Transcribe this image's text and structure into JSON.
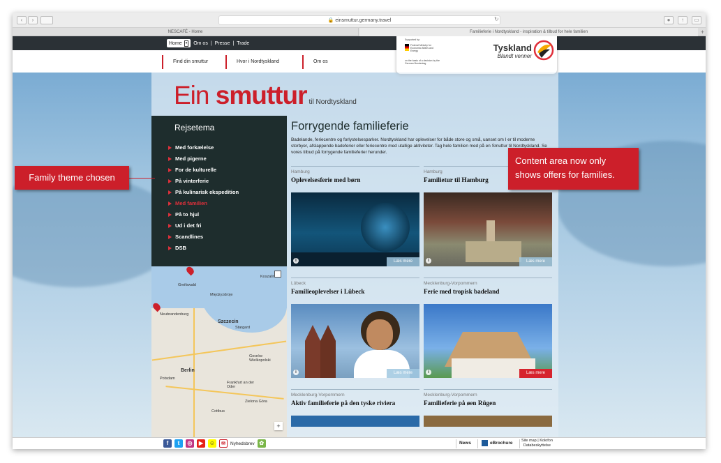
{
  "browser": {
    "url": "einsmuttur.germany.travel",
    "tabs": [
      {
        "label": "NESCAFÉ - Home"
      },
      {
        "label": "Familieferie i Nordtyskland - inspiration & tilbud for hele familien"
      }
    ],
    "new_tab_label": "+"
  },
  "topbar": {
    "home_label": "Home",
    "links": [
      "Om os",
      "Presse",
      "Trade"
    ]
  },
  "nav": {
    "items": [
      "Find din smuttur",
      "Hvor i Nordtyskland",
      "Om os"
    ]
  },
  "logo": {
    "supported_by": "Supported by:",
    "ministry": "Federal Ministry for Economic Affairs and Energy",
    "decision": "on the basis of a decision by the German Bundestag",
    "brand": "Tyskland",
    "tagline": "Blandt venner"
  },
  "site_title": {
    "ein": "Ein ",
    "smuttur": "smuttur",
    "suffix": "til Nordtyskland"
  },
  "menu": {
    "heading": "Rejsetema",
    "items": [
      {
        "label": "Med forkælelse",
        "active": false
      },
      {
        "label": "Med pigerne",
        "active": false
      },
      {
        "label": "For de kulturelle",
        "active": false
      },
      {
        "label": "På vinterferie",
        "active": false
      },
      {
        "label": "På kulinarisk ekspedition",
        "active": false
      },
      {
        "label": "Med familien",
        "active": true
      },
      {
        "label": "På to hjul",
        "active": false
      },
      {
        "label": "Ud i det fri",
        "active": false
      },
      {
        "label": "Scandlines",
        "active": false
      },
      {
        "label": "DSB",
        "active": false
      }
    ]
  },
  "map": {
    "labels": [
      "Greifswald",
      "Neubrandenburg",
      "Szczecin",
      "Stargard",
      "Gorzów Wielkopolski",
      "Berlin",
      "Potsdam",
      "Frankfurt an der Oder",
      "Zielona Góra",
      "Cottbus",
      "Międzyzdroje",
      "Koszalin"
    ],
    "zoom_label": "+"
  },
  "main": {
    "heading": "Forrygende familieferie",
    "intro": "Badelande, feriecentre og forlystelsesparker. Nordtyskland har oplevelser for både store og små, uanset om I er til moderne storbyer, afslappende badeferier eller feriecentre med utallige aktiviteter. Tag hele familien med på en Smuttur til Nordtyskland. Se vores tilbud på forrygende familieferier herunder.",
    "read_more": "Læs mere",
    "cards": [
      {
        "region": "Hamburg",
        "title": "Oplevelsesferie med børn"
      },
      {
        "region": "Hamburg",
        "title": "Familietur til Hamburg"
      },
      {
        "region": "Lübeck",
        "title": "Familieoplevelser i Lübeck"
      },
      {
        "region": "Mecklenburg-Vorpommern",
        "title": "Ferie med tropisk badeland"
      },
      {
        "region": "Mecklenburg-Vorpommern",
        "title": "Aktiv familieferie på den tyske riviera"
      },
      {
        "region": "Mecklenburg-Vorpommern",
        "title": "Familieferie på øen Rügen"
      }
    ]
  },
  "callouts": {
    "left": "Family theme chosen",
    "right": "Content area now only shows offers for families."
  },
  "footer": {
    "newsletter": "Nyhedsbrev",
    "news": "News",
    "ebrochure": "eBrochure",
    "sitemap": "Site map",
    "kolofon": "Kolofon",
    "privacy": "Databeskyttelse"
  },
  "colors": {
    "accent": "#cc1f2a",
    "menu_bg": "#1e2d2d"
  }
}
